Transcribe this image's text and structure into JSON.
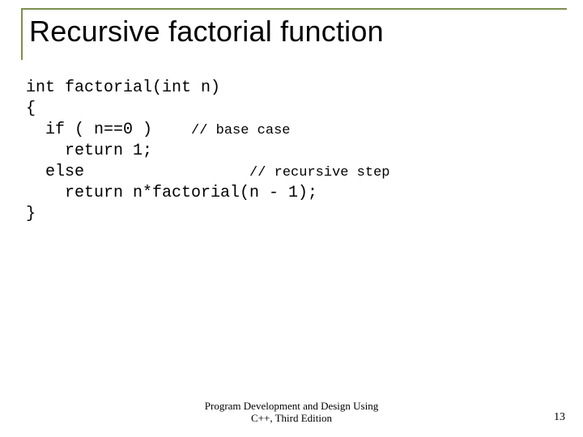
{
  "title": "Recursive factorial function",
  "code": {
    "l1": "int factorial(int n)",
    "l2": "{",
    "l3a": "  if ( n==0 )    ",
    "l3b": "// base case",
    "l4": "    return 1;",
    "l5a": "  else                 ",
    "l5b": "// recursive step",
    "l6": "    return n*factorial(n - 1);",
    "l7": "}"
  },
  "footer": {
    "line1": "Program Development and Design Using",
    "line2": "C++, Third Edition"
  },
  "page": "13"
}
